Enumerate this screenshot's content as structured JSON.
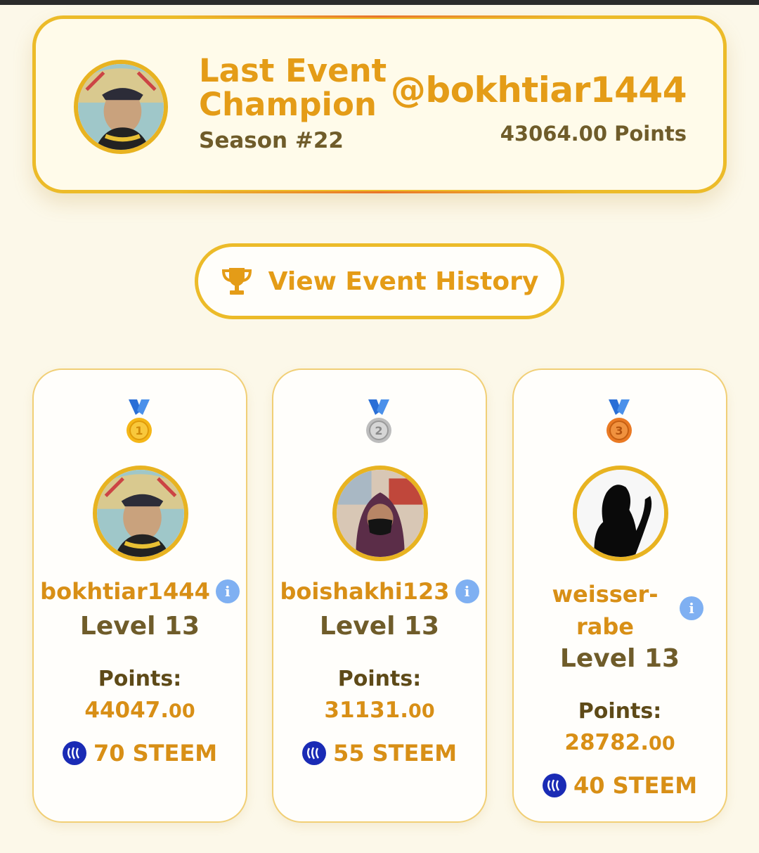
{
  "champion": {
    "label_line1": "Last Event",
    "label_line2": "Champion",
    "season": "Season #22",
    "username": "@bokhtiar1444",
    "points": "43064.00 Points"
  },
  "history_button": {
    "label": "View Event History",
    "icon": "trophy-icon"
  },
  "leaderboard": [
    {
      "rank": "1",
      "medal": "gold-medal-icon",
      "username": "bokhtiar1444",
      "level": "Level 13",
      "points_label": "Points:",
      "points_int": "44047.",
      "points_dec": "00",
      "reward": "70 STEEM"
    },
    {
      "rank": "2",
      "medal": "silver-medal-icon",
      "username": "boishakhi123",
      "level": "Level 13",
      "points_label": "Points:",
      "points_int": "31131.",
      "points_dec": "00",
      "reward": "55 STEEM"
    },
    {
      "rank": "3",
      "medal": "bronze-medal-icon",
      "username": "weisser-rabe",
      "username_line1": "weisser-",
      "username_line2": "rabe",
      "level": "Level 13",
      "points_label": "Points:",
      "points_int": "28782.",
      "points_dec": "00",
      "reward": "40 STEEM"
    }
  ],
  "colors": {
    "background": "#fcf8e9",
    "accent": "#e49c17",
    "border": "#ecbb29",
    "text_dark": "#6f5c2a",
    "info": "#7fb0f2",
    "steem": "#1a2bb5"
  }
}
